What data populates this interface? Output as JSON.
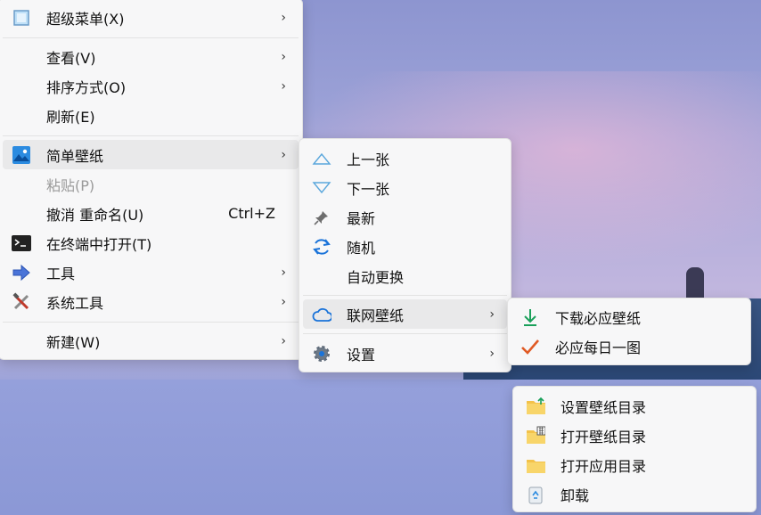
{
  "main_menu": {
    "items": [
      {
        "label": "超级菜单(X)",
        "icon": "super-menu-icon"
      },
      {
        "label": "查看(V)"
      },
      {
        "label": "排序方式(O)"
      },
      {
        "label": "刷新(E)"
      },
      {
        "label": "简单壁纸",
        "icon": "picture-icon"
      },
      {
        "label": "粘贴(P)"
      },
      {
        "label": "撤消 重命名(U)",
        "shortcut": "Ctrl+Z"
      },
      {
        "label": "在终端中打开(T)",
        "icon": "terminal-icon"
      },
      {
        "label": "工具",
        "icon": "arrow-right-icon"
      },
      {
        "label": "系统工具",
        "icon": "tools-icon"
      },
      {
        "label": "新建(W)"
      }
    ]
  },
  "wallpaper_menu": {
    "items": [
      {
        "label": "上一张",
        "icon": "triangle-up-icon"
      },
      {
        "label": "下一张",
        "icon": "triangle-down-icon"
      },
      {
        "label": "最新",
        "icon": "pin-icon"
      },
      {
        "label": "随机",
        "icon": "refresh-icon"
      },
      {
        "label": "自动更换"
      },
      {
        "label": "联网壁纸",
        "icon": "cloud-icon"
      },
      {
        "label": "设置",
        "icon": "gear-icon"
      }
    ]
  },
  "online_menu": {
    "items": [
      {
        "label": "下载必应壁纸",
        "icon": "download-icon"
      },
      {
        "label": "必应每日一图",
        "icon": "checkmark-icon"
      }
    ]
  },
  "settings_menu": {
    "items": [
      {
        "label": "设置壁纸目录",
        "icon": "folder-up-icon"
      },
      {
        "label": "打开壁纸目录",
        "icon": "folder-grid-icon"
      },
      {
        "label": "打开应用目录",
        "icon": "folder-icon"
      },
      {
        "label": "卸载",
        "icon": "recycle-icon"
      }
    ]
  },
  "arrow_glyph": "›",
  "colors": {
    "accent": "#1a73d9",
    "check": "#e05a24",
    "download": "#1aa05a"
  }
}
